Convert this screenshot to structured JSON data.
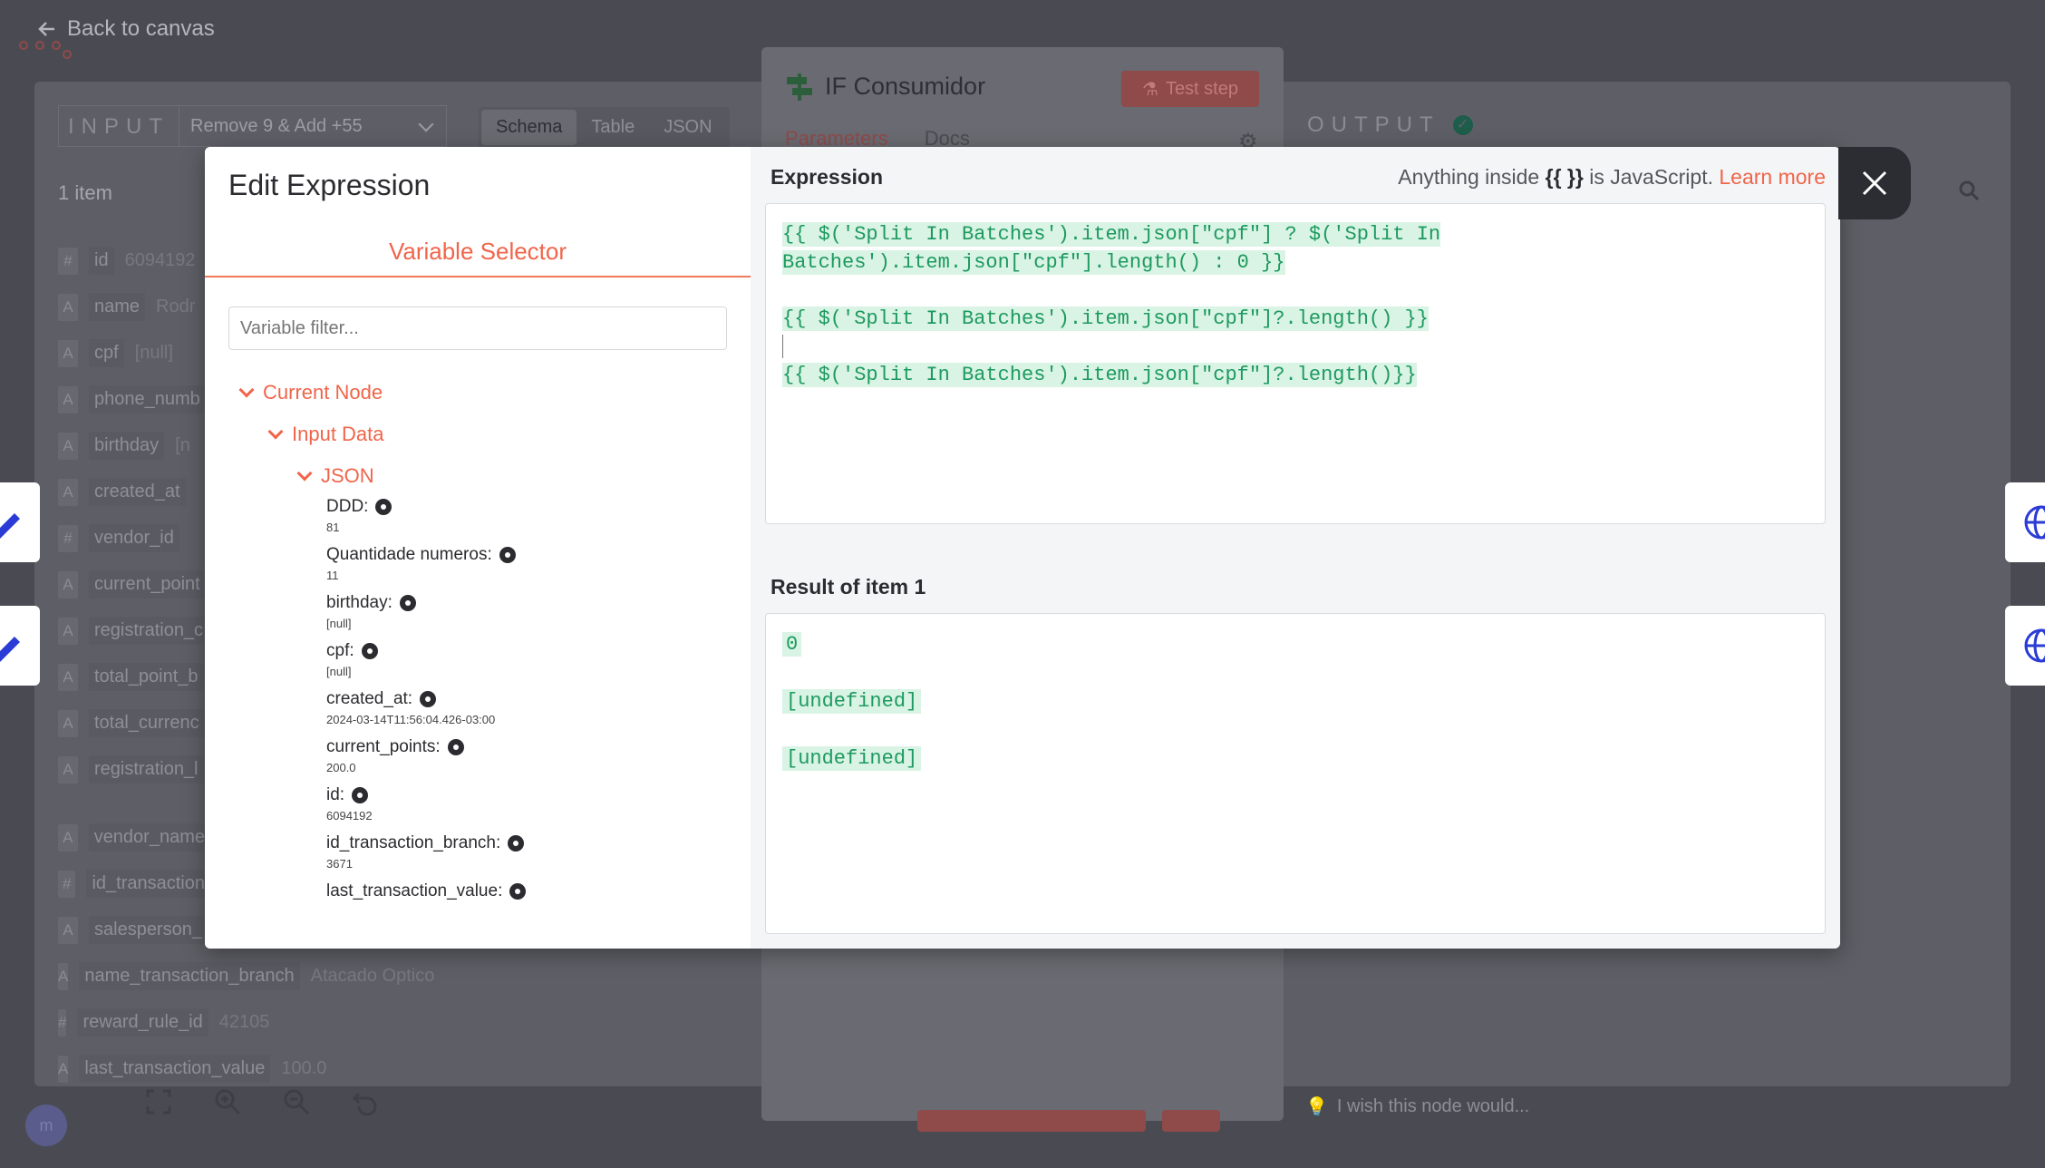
{
  "topbar": {
    "back_label": "Back to canvas"
  },
  "input": {
    "title": "INPUT",
    "selected_node": "Remove 9 & Add +55",
    "view_tabs": [
      "Schema",
      "Table",
      "JSON"
    ],
    "item_count": "1 item",
    "schema": [
      {
        "type": "#",
        "key": "id",
        "value": "6094192"
      },
      {
        "type": "A",
        "key": "name",
        "value": "Rodr"
      },
      {
        "type": "A",
        "key": "cpf",
        "value": "[null]"
      },
      {
        "type": "A",
        "key": "phone_numb",
        "value": ""
      },
      {
        "type": "A",
        "key": "birthday",
        "value": "[n"
      },
      {
        "type": "A",
        "key": "created_at",
        "value": ""
      },
      {
        "type": "#",
        "key": "vendor_id",
        "value": ""
      },
      {
        "type": "A",
        "key": "current_point",
        "value": ""
      },
      {
        "type": "A",
        "key": "registration_c",
        "value": ""
      },
      {
        "type": "A",
        "key": "total_point_b",
        "value": ""
      },
      {
        "type": "A",
        "key": "total_currenc",
        "value": ""
      },
      {
        "type": "A",
        "key": "registration_l",
        "value": ""
      }
    ],
    "schema_lower": [
      {
        "type": "A",
        "key": "vendor_name",
        "value": ""
      },
      {
        "type": "#",
        "key": "id_transaction",
        "value": ""
      },
      {
        "type": "A",
        "key": "salesperson_",
        "value": ""
      },
      {
        "type": "A",
        "key": "name_transaction_branch",
        "value": "Atacado Optico"
      },
      {
        "type": "#",
        "key": "reward_rule_id",
        "value": "42105"
      },
      {
        "type": "A",
        "key": "last_transaction_value",
        "value": "100.0"
      }
    ]
  },
  "node": {
    "title": "IF Consumidor",
    "test_step": "Test step",
    "tabs": [
      "Parameters",
      "Docs"
    ]
  },
  "output": {
    "title": "OUTPUT"
  },
  "wish_text": "I wish this node would...",
  "avatar": "m",
  "modal": {
    "title": "Edit Expression",
    "variable_selector": "Variable Selector",
    "filter_placeholder": "Variable filter...",
    "tree": {
      "current_node": "Current Node",
      "input_data": "Input Data",
      "json": "JSON",
      "fields": [
        {
          "name": "DDD:",
          "value": "81"
        },
        {
          "name": "Quantidade numeros:",
          "value": "11"
        },
        {
          "name": "birthday:",
          "value": "[null]"
        },
        {
          "name": "cpf:",
          "value": "[null]"
        },
        {
          "name": "created_at:",
          "value": "2024-03-14T11:56:04.426-03:00"
        },
        {
          "name": "current_points:",
          "value": "200.0"
        },
        {
          "name": "id:",
          "value": "6094192"
        },
        {
          "name": "id_transaction_branch:",
          "value": "3671"
        },
        {
          "name": "last_transaction_value:",
          "value": ""
        }
      ]
    },
    "expression_label": "Expression",
    "hint_prefix": "Anything inside",
    "hint_braces": "{{ }}",
    "hint_suffix": "is JavaScript.",
    "learn_more": "Learn more",
    "expression_lines": [
      "{{ $('Split In Batches').item.json[\"cpf\"] ? $('Split In ",
      "Batches').item.json[\"cpf\"].length() : 0 }}",
      "",
      "{{ $('Split In Batches').item.json[\"cpf\"]?.length() }}",
      "",
      "{{ $('Split In Batches').item.json[\"cpf\"]?.length()}}"
    ],
    "result_label": "Result of item 1",
    "results": [
      "0",
      "[undefined]",
      "[undefined]"
    ]
  },
  "colors": {
    "accent": "#f0654a",
    "expression_green": "#1d9a5f",
    "expression_bg": "#d9f3e4"
  }
}
